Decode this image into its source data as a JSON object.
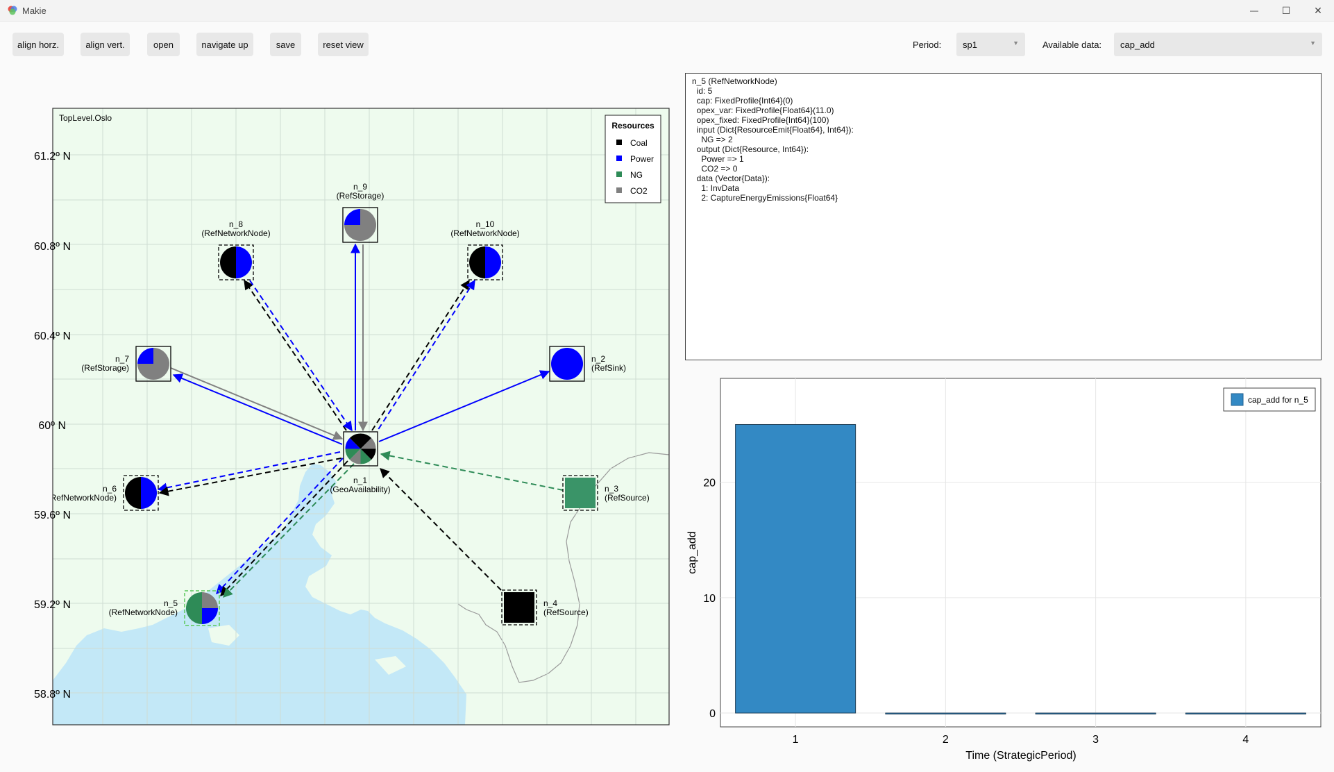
{
  "window": {
    "title": "Makie",
    "minimize_glyph": "—",
    "maximize_glyph": "☐",
    "close_glyph": "✕"
  },
  "toolbar": {
    "buttons": [
      "align horz.",
      "align vert.",
      "open",
      "navigate up",
      "save",
      "reset view"
    ],
    "period_label": "Period:",
    "period_value": "sp1",
    "available_label": "Available data:",
    "available_value": "cap_add"
  },
  "map": {
    "title": "TopLevel.Oslo",
    "lat_labels": [
      "61.2º N",
      "60.8º N",
      "60.4º N",
      "60º N",
      "59.6º N",
      "59.2º N",
      "58.8º N"
    ],
    "legend_title": "Resources",
    "resources": [
      {
        "name": "Coal",
        "color": "#000000"
      },
      {
        "name": "Power",
        "color": "#0000ff"
      },
      {
        "name": "NG",
        "color": "#2e8b57"
      },
      {
        "name": "CO2",
        "color": "#808080"
      }
    ],
    "nodes": {
      "n_1": {
        "name": "n_1",
        "type": "(GeoAvailability)"
      },
      "n_2": {
        "name": "n_2",
        "type": "(RefSink)"
      },
      "n_3": {
        "name": "n_3",
        "type": "(RefSource)"
      },
      "n_4": {
        "name": "n_4",
        "type": "(RefSource)"
      },
      "n_5": {
        "name": "n_5",
        "type": "(RefNetworkNode)"
      },
      "n_6": {
        "name": "n_6",
        "type": "(RefNetworkNode)"
      },
      "n_7": {
        "name": "n_7",
        "type": "(RefStorage)"
      },
      "n_8": {
        "name": "n_8",
        "type": "(RefNetworkNode)"
      },
      "n_9": {
        "name": "n_9",
        "type": "(RefStorage)"
      },
      "n_10": {
        "name": "n_10",
        "type": "(RefNetworkNode)"
      }
    }
  },
  "info_text": "n_5 (RefNetworkNode)\n  id: 5\n  cap: FixedProfile{Int64}(0)\n  opex_var: FixedProfile{Float64}(11.0)\n  opex_fixed: FixedProfile{Int64}(100)\n  input (Dict{ResourceEmit{Float64}, Int64}):\n    NG => 2\n  output (Dict{Resource, Int64}):\n    Power => 1\n    CO2 => 0\n  data (Vector{Data}):\n    1: InvData\n    2: CaptureEnergyEmissions{Float64}",
  "chart_data": {
    "type": "bar",
    "categories": [
      "1",
      "2",
      "3",
      "4"
    ],
    "values": [
      25,
      0,
      0,
      0
    ],
    "series": [
      {
        "name": "cap_add for n_5",
        "values": [
          25,
          0,
          0,
          0
        ]
      }
    ],
    "xlabel": "Time (StrategicPeriod)",
    "ylabel": "cap_add",
    "yticks": [
      "0",
      "10",
      "20"
    ],
    "ylim": [
      -1.2,
      29
    ],
    "bar_color": "#3389c4",
    "grid": true,
    "legend_position": "top-right"
  }
}
